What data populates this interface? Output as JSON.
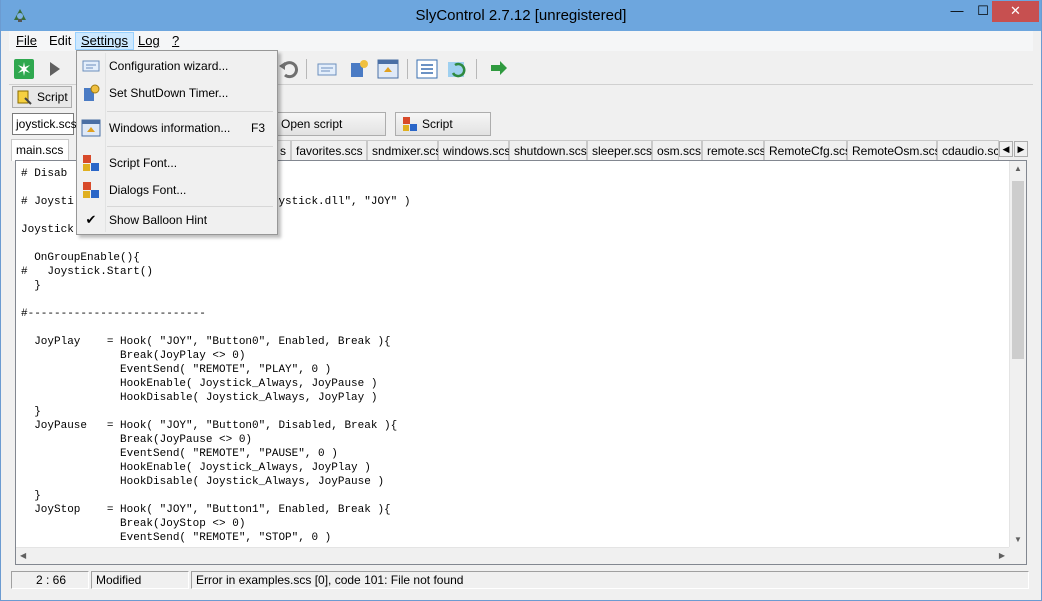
{
  "window": {
    "title": "SlyControl 2.7.12 [unregistered]",
    "minimize_glyph": "—",
    "maximize_glyph": "☐",
    "close_glyph": "✕"
  },
  "menubar": {
    "file": "File",
    "edit": "Edit",
    "settings": "Settings",
    "log": "Log",
    "help": "?"
  },
  "toolbar": {
    "icons": [
      "start-icon",
      "play-icon",
      "undo-icon",
      "edit-script-icon",
      "windows-info-icon",
      "config-icon",
      "screen-icon",
      "list-icon",
      "refresh-icon",
      "go-icon"
    ]
  },
  "row2": {
    "script_button": "Script"
  },
  "row3": {
    "file_combo": "joystick.scs",
    "open_folder_button": "Open script folder...",
    "script_font_button": "Script Font..."
  },
  "tabs": [
    "main.scs",
    "s",
    "favorites.scs",
    "sndmixer.scs",
    "windows.scs",
    "shutdown.scs",
    "sleeper.scs",
    "osm.scs",
    "remote.scs",
    "RemoteCfg.scs",
    "RemoteOsm.scs",
    "cdaudio.scs"
  ],
  "tab_scroll": {
    "left": "◀",
    "right": "▶"
  },
  "editor": {
    "code": "# Disab\n\n# Joysti                             Joystick.dll\", \"JOY\" )\n\nJoystick\n\n  OnGroupEnable(){\n#   Joystick.Start()\n  }\n\n#---------------------------\n\n  JoyPlay    = Hook( \"JOY\", \"Button0\", Enabled, Break ){\n               Break(JoyPlay <> 0)\n               EventSend( \"REMOTE\", \"PLAY\", 0 )\n               HookEnable( Joystick_Always, JoyPause )\n               HookDisable( Joystick_Always, JoyPlay )\n  }\n  JoyPause   = Hook( \"JOY\", \"Button0\", Disabled, Break ){\n               Break(JoyPause <> 0)\n               EventSend( \"REMOTE\", \"PAUSE\", 0 )\n               HookEnable( Joystick_Always, JoyPlay )\n               HookDisable( Joystick_Always, JoyPause )\n  }\n  JoyStop    = Hook( \"JOY\", \"Button1\", Enabled, Break ){\n               Break(JoyStop <> 0)\n               EventSend( \"REMOTE\", \"STOP\", 0 )"
  },
  "statusbar": {
    "position": "2 : 66",
    "state": "Modified",
    "message": "Error in examples.scs [0], code 101: File not found"
  },
  "settings_menu": {
    "items": [
      {
        "label": "Configuration wizard...",
        "shortcut": "",
        "icon": "wizard-icon"
      },
      {
        "label": "Set ShutDown Timer...",
        "shortcut": "",
        "icon": "timer-icon"
      },
      {
        "label": "Windows information...",
        "shortcut": "F3",
        "icon": "windows-info-icon"
      },
      {
        "label": "Script Font...",
        "shortcut": "",
        "icon": "font-icon"
      },
      {
        "label": "Dialogs Font...",
        "shortcut": "",
        "icon": "font-icon"
      },
      {
        "label": "Show Balloon Hint",
        "shortcut": "",
        "icon": "check-icon",
        "checked": true
      }
    ]
  },
  "colors": {
    "titlebar": "#6da6de",
    "close_button": "#c75050",
    "menu_highlight": "#cce8ff"
  }
}
